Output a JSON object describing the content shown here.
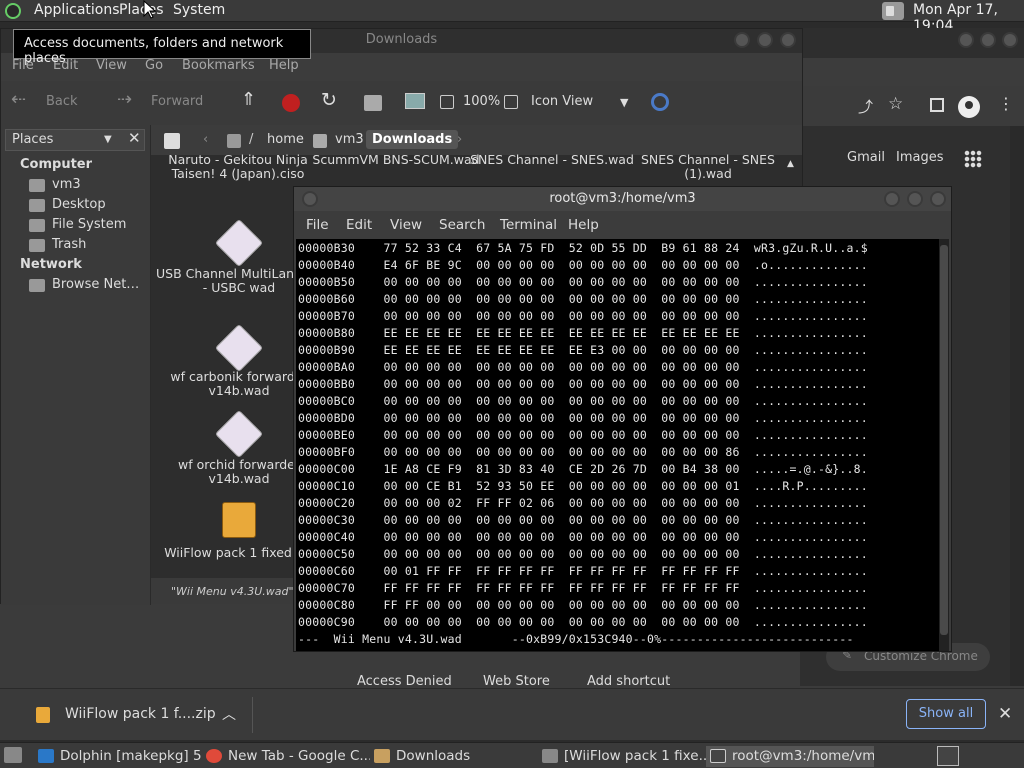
{
  "top_panel": {
    "menus": [
      "Applications",
      "Places",
      "System"
    ],
    "clock": "Mon Apr 17, 19:04"
  },
  "tooltip": "Access documents, folders and network places",
  "nautilus": {
    "title": "Downloads",
    "menu": [
      "File",
      "Edit",
      "View",
      "Go",
      "Bookmarks",
      "Help"
    ],
    "toolbar": {
      "back": "Back",
      "forward": "Forward",
      "zoom": "100%",
      "view_mode": "Icon View"
    },
    "path": [
      "home",
      "vm3",
      "Downloads"
    ],
    "places_label": "Places",
    "sidebar": {
      "computer_header": "Computer",
      "computer_items": [
        "vm3",
        "Desktop",
        "File System",
        "Trash"
      ],
      "network_header": "Network",
      "network_items": [
        "Browse Net…"
      ]
    },
    "files": [
      {
        "name": "Naruto - Gekitou Ninja Taisen! 4 (Japan).ciso"
      },
      {
        "name": "ScummVM BNS-SCUM.wad"
      },
      {
        "name": "SNES Channel - SNES.wad"
      },
      {
        "name": "SNES Channel - SNES (1).wad"
      },
      {
        "name": "USB Channel MultiLangV2i - USBC wad"
      },
      {
        "name": "wf carbonik forwarder v14b.wad"
      },
      {
        "name": "wf orchid forwarder v14b.wad"
      },
      {
        "name": "WiiFlow pack 1 fixed zip"
      }
    ],
    "status": "\"Wii Menu v4.3U.wad\" sel"
  },
  "terminal": {
    "title": "root@vm3:/home/vm3",
    "menu": [
      "File",
      "Edit",
      "View",
      "Search",
      "Terminal",
      "Help"
    ],
    "rows": [
      "00000B30    77 52 33 C4  67 5A 75 FD  52 0D 55 DD  B9 61 88 24  wR3.gZu.R.U..a.$",
      "00000B40    E4 6F BE 9C  00 00 00 00  00 00 00 00  00 00 00 00  .o..............",
      "00000B50    00 00 00 00  00 00 00 00  00 00 00 00  00 00 00 00  ................",
      "00000B60    00 00 00 00  00 00 00 00  00 00 00 00  00 00 00 00  ................",
      "00000B70    00 00 00 00  00 00 00 00  00 00 00 00  00 00 00 00  ................",
      "00000B80    EE EE EE EE  EE EE EE EE  EE EE EE EE  EE EE EE EE  ................",
      "00000B90    EE EE EE EE  EE EE EE EE  EE E3 00 00  00 00 00 00  ................",
      "00000BA0    00 00 00 00  00 00 00 00  00 00 00 00  00 00 00 00  ................",
      "00000BB0    00 00 00 00  00 00 00 00  00 00 00 00  00 00 00 00  ................",
      "00000BC0    00 00 00 00  00 00 00 00  00 00 00 00  00 00 00 00  ................",
      "00000BD0    00 00 00 00  00 00 00 00  00 00 00 00  00 00 00 00  ................",
      "00000BE0    00 00 00 00  00 00 00 00  00 00 00 00  00 00 00 00  ................",
      "00000BF0    00 00 00 00  00 00 00 00  00 00 00 00  00 00 00 86  ................",
      "00000C00    1E A8 CE F9  81 3D 83 40  CE 2D 26 7D  00 B4 38 00  .....=.@.-&}..8.",
      "00000C10    00 00 CE B1  52 93 50 EE  00 00 00 00  00 00 00 01  ....R.P.........",
      "00000C20    00 00 00 02  FF FF 02 06  00 00 00 00  00 00 00 00  ................",
      "00000C30    00 00 00 00  00 00 00 00  00 00 00 00  00 00 00 00  ................",
      "00000C40    00 00 00 00  00 00 00 00  00 00 00 00  00 00 00 00  ................",
      "00000C50    00 00 00 00  00 00 00 00  00 00 00 00  00 00 00 00  ................",
      "00000C60    00 01 FF FF  FF FF FF FF  FF FF FF FF  FF FF FF FF  ................",
      "00000C70    FF FF FF FF  FF FF FF FF  FF FF FF FF  FF FF FF FF  ................",
      "00000C80    FF FF 00 00  00 00 00 00  00 00 00 00  00 00 00 00  ................",
      "00000C90    00 00 00 00  00 00 00 00  00 00 00 00  00 00 00 00  ................"
    ],
    "status_line": "---  Wii Menu v4.3U.wad       --0xB99/0x153C940--0%---------------------------"
  },
  "chrome": {
    "gmail": "Gmail",
    "images": "Images",
    "customize": "Customize Chrome",
    "shortcuts": [
      "Access Denied",
      "Web Store",
      "Add shortcut"
    ],
    "download_item": "WiiFlow pack 1 f....zip",
    "show_all": "Show all"
  },
  "taskbar": [
    {
      "label": "Dolphin [makepkg] 5...",
      "icon_color": "#2a78c8"
    },
    {
      "label": "New Tab - Google C...",
      "icon_color": "#e04a3a"
    },
    {
      "label": "Downloads",
      "icon_color": "#c8a060"
    },
    {
      "label": "[WiiFlow pack 1 fixe...",
      "icon_color": "#888888"
    },
    {
      "label": "root@vm3:/home/vm3",
      "icon_color": "#444444"
    }
  ]
}
